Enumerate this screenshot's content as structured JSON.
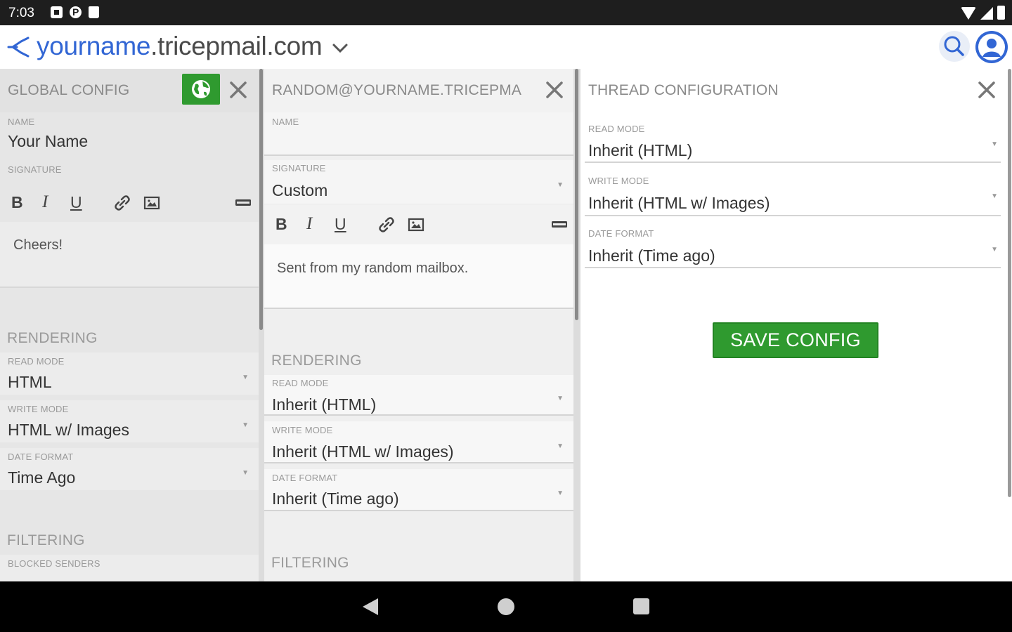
{
  "status_bar": {
    "time": "7:03"
  },
  "app_bar": {
    "domain_user": "yourname",
    "domain_rest": ".tricepmail.com"
  },
  "global_config": {
    "title": "GLOBAL CONFIG",
    "name_label": "NAME",
    "name_value": "Your Name",
    "signature_label": "SIGNATURE",
    "signature_text": "Cheers!",
    "rendering_heading": "RENDERING",
    "read_mode_label": "READ MODE",
    "read_mode_value": "HTML",
    "write_mode_label": "WRITE MODE",
    "write_mode_value": "HTML w/ Images",
    "date_format_label": "DATE FORMAT",
    "date_format_value": "Time Ago",
    "filtering_heading": "FILTERING",
    "blocked_senders_label": "BLOCKED SENDERS"
  },
  "mailbox_config": {
    "title": "RANDOM@YOURNAME.TRICEPMA",
    "name_label": "NAME",
    "name_value": "",
    "signature_label": "SIGNATURE",
    "signature_mode": "Custom",
    "signature_text": "Sent from my random mailbox.",
    "rendering_heading": "RENDERING",
    "read_mode_label": "READ MODE",
    "read_mode_value": "Inherit (HTML)",
    "write_mode_label": "WRITE MODE",
    "write_mode_value": "Inherit (HTML w/ Images)",
    "date_format_label": "DATE FORMAT",
    "date_format_value": "Inherit (Time ago)",
    "filtering_heading": "FILTERING"
  },
  "thread_config": {
    "title": "THREAD CONFIGURATION",
    "read_mode_label": "READ MODE",
    "read_mode_value": "Inherit (HTML)",
    "write_mode_label": "WRITE MODE",
    "write_mode_value": "Inherit (HTML w/ Images)",
    "date_format_label": "DATE FORMAT",
    "date_format_value": "Inherit (Time ago)",
    "save_label": "SAVE CONFIG"
  },
  "toolbar": {
    "bold": "B",
    "italic": "I",
    "underline": "U"
  },
  "dropdown_arrow": "▼",
  "icons": [
    "status-a-icon",
    "status-p-icon",
    "status-card-icon",
    "wifi-icon",
    "cell-signal-icon",
    "battery-icon",
    "app-logo-icon",
    "chevron-down-icon",
    "search-icon",
    "account-icon",
    "globe-icon",
    "close-icon",
    "link-icon",
    "image-icon",
    "keyboard-icon",
    "back-icon",
    "home-icon",
    "recents-icon"
  ],
  "colors": {
    "accent": "#3266d4",
    "save_green": "#2f9a2f"
  }
}
